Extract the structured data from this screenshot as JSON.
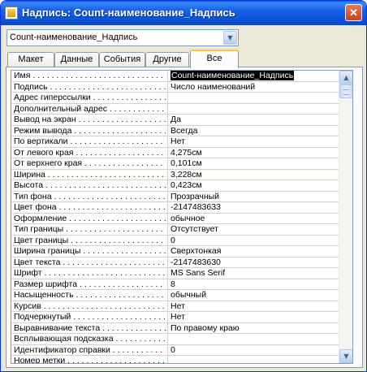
{
  "window": {
    "title": "Надпись: Count-наименование_Надпись",
    "icon": "form-label-icon",
    "close_label": "✕"
  },
  "object_selector": {
    "value": "Count-наименование_Надпись",
    "dropdown_icon": "chevron-down-icon"
  },
  "tabs": [
    {
      "label": "Макет",
      "active": false
    },
    {
      "label": "Данные",
      "active": false
    },
    {
      "label": "События",
      "active": false
    },
    {
      "label": "Другие",
      "active": false
    },
    {
      "label": "Все",
      "active": true
    }
  ],
  "properties": [
    {
      "label": "Имя",
      "value": "Count-наименование_Надпись",
      "selected": true
    },
    {
      "label": "Подпись",
      "value": "Число наименований"
    },
    {
      "label": "Адрес гиперссылки",
      "value": ""
    },
    {
      "label": "Дополнительный адрес",
      "value": ""
    },
    {
      "label": "Вывод на экран",
      "value": "Да"
    },
    {
      "label": "Режим вывода",
      "value": "Всегда"
    },
    {
      "label": "По вертикали",
      "value": "Нет"
    },
    {
      "label": "От левого края",
      "value": "4,275см"
    },
    {
      "label": "От верхнего края",
      "value": "0,101см"
    },
    {
      "label": "Ширина",
      "value": "3,228см"
    },
    {
      "label": "Высота",
      "value": "0,423см"
    },
    {
      "label": "Тип фона",
      "value": "Прозрачный"
    },
    {
      "label": "Цвет фона",
      "value": "-2147483633"
    },
    {
      "label": "Оформление",
      "value": "обычное"
    },
    {
      "label": "Тип границы",
      "value": "Отсутствует"
    },
    {
      "label": "Цвет границы",
      "value": "0"
    },
    {
      "label": "Ширина границы",
      "value": "Сверхтонкая"
    },
    {
      "label": "Цвет текста",
      "value": "-2147483630"
    },
    {
      "label": "Шрифт",
      "value": "MS Sans Serif"
    },
    {
      "label": "Размер шрифта",
      "value": "8"
    },
    {
      "label": "Насыщенность",
      "value": "обычный"
    },
    {
      "label": "Курсив",
      "value": "Нет"
    },
    {
      "label": "Подчеркнутый",
      "value": "Нет"
    },
    {
      "label": "Выравнивание текста",
      "value": "По правому краю"
    },
    {
      "label": "Всплывающая подсказка",
      "value": ""
    },
    {
      "label": "Идентификатор справки",
      "value": "0"
    },
    {
      "label": "Номер метки",
      "value": ""
    }
  ],
  "scrollbar": {
    "up_icon": "chevron-up-icon",
    "down_icon": "chevron-down-icon"
  },
  "colors": {
    "titlebar": "#0a5ee6",
    "close_button": "#c7421d",
    "active_tab_accent": "#ffc83c",
    "window_face": "#ece9d8",
    "selection": "#000000"
  }
}
